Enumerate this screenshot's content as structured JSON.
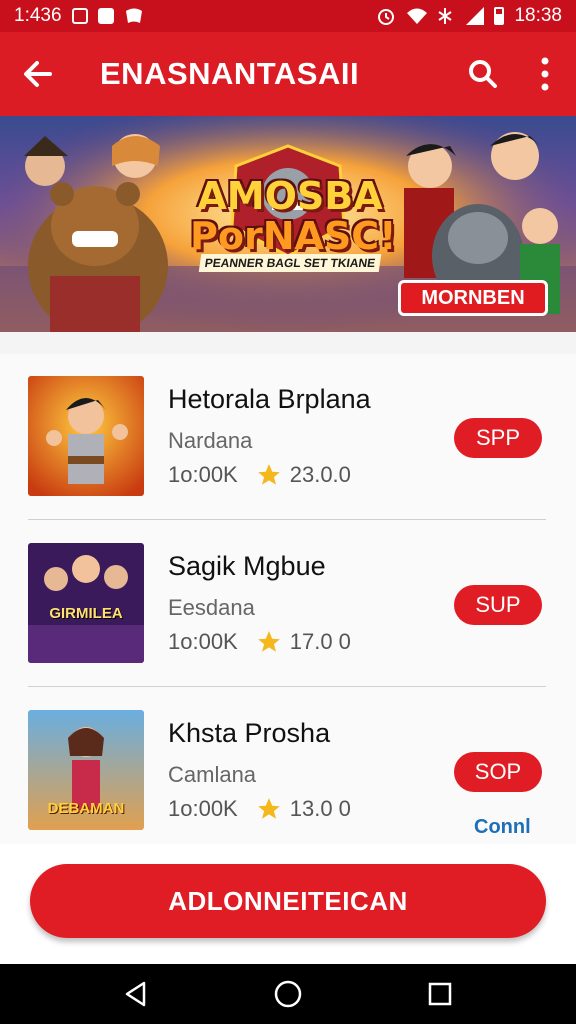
{
  "status_bar": {
    "time_left": "1:436",
    "time_right": "18:38",
    "icons_left": [
      "image-icon",
      "stop-icon",
      "game-icon"
    ],
    "icons_right": [
      "alarm-icon",
      "wifi-icon",
      "bluetooth-icon",
      "signal-icon",
      "battery-icon"
    ]
  },
  "app_bar": {
    "title": "ENASNANTASAII",
    "back_icon": "back-arrow-icon",
    "search_icon": "search-icon",
    "menu_icon": "more-vert-icon"
  },
  "banner": {
    "title_line1": "AMOSBA",
    "title_line2": "PorNASC!",
    "subtitle": "PEANNER BAGL SET TKIANE",
    "button": "MORNBEN"
  },
  "items": [
    {
      "name": "Hetorala Brplana",
      "developer": "Nardana",
      "downloads": "1o:00K",
      "rating": "23.0.0",
      "button": "SPP"
    },
    {
      "name": "Sagik Mgbue",
      "developer": "Eesdana",
      "downloads": "1o:00K",
      "rating": "17.0 0",
      "button": "SUP",
      "thumb_text": "GIRMILEA"
    },
    {
      "name": "Khsta Prosha",
      "developer": "Camlana",
      "downloads": "1o:00K",
      "rating": "13.0 0",
      "button": "SOP",
      "thumb_text": "DEBAMAN"
    }
  ],
  "conn_link": "Connl",
  "cta_button": "ADLONNEITEICAN",
  "nav": [
    "back-nav-icon",
    "home-nav-icon",
    "recents-nav-icon"
  ],
  "colors": {
    "primary": "#dc1c24",
    "status": "#c8101c",
    "link": "#1e6fb8",
    "star": "#f5b81c"
  }
}
